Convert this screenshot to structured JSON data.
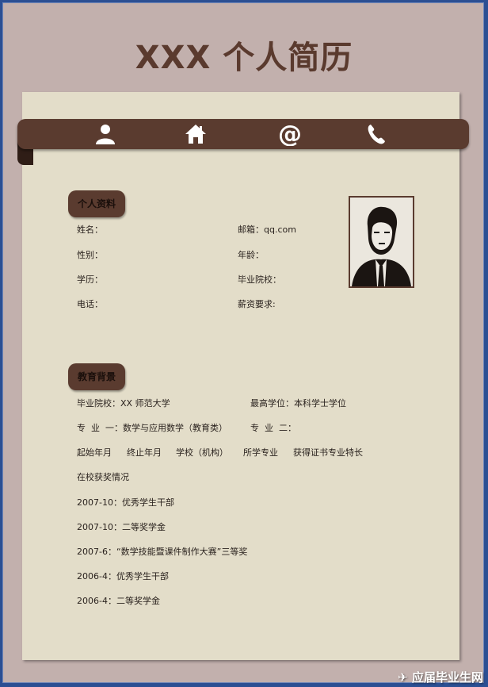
{
  "title": "XXX 个人简历",
  "icons": [
    "person-icon",
    "home-icon",
    "at-icon",
    "phone-icon"
  ],
  "personal": {
    "heading": "个人资料",
    "left": [
      "姓名：",
      "性别：",
      "学历：",
      "电话："
    ],
    "right": [
      "邮箱：qq.com",
      "年龄：",
      "毕业院校：",
      "薪资要求:"
    ]
  },
  "education": {
    "heading": "教育背景",
    "school": "毕业院校：XX 师范大学",
    "degree": "最高学位：本科学士学位",
    "major1": "专  业  一：数学与应用数学（教育类）",
    "major2": "专  业  二：",
    "cols": [
      "起始年月",
      "终止年月",
      "学校（机构）",
      "所学专业",
      "获得证书专业特长"
    ],
    "awards_title": "在校获奖情况",
    "awards": [
      "2007-10：优秀学生干部",
      "2007-10：二等奖学金",
      "2007-6：“数学技能暨课件制作大赛”三等奖",
      "2006-4：优秀学生干部",
      "2006-4：二等奖学金"
    ]
  },
  "watermark": "应届毕业生网",
  "colors": {
    "accent": "#5a3b2f",
    "paper": "#e3ddc9",
    "background": "#c2b0ad"
  }
}
